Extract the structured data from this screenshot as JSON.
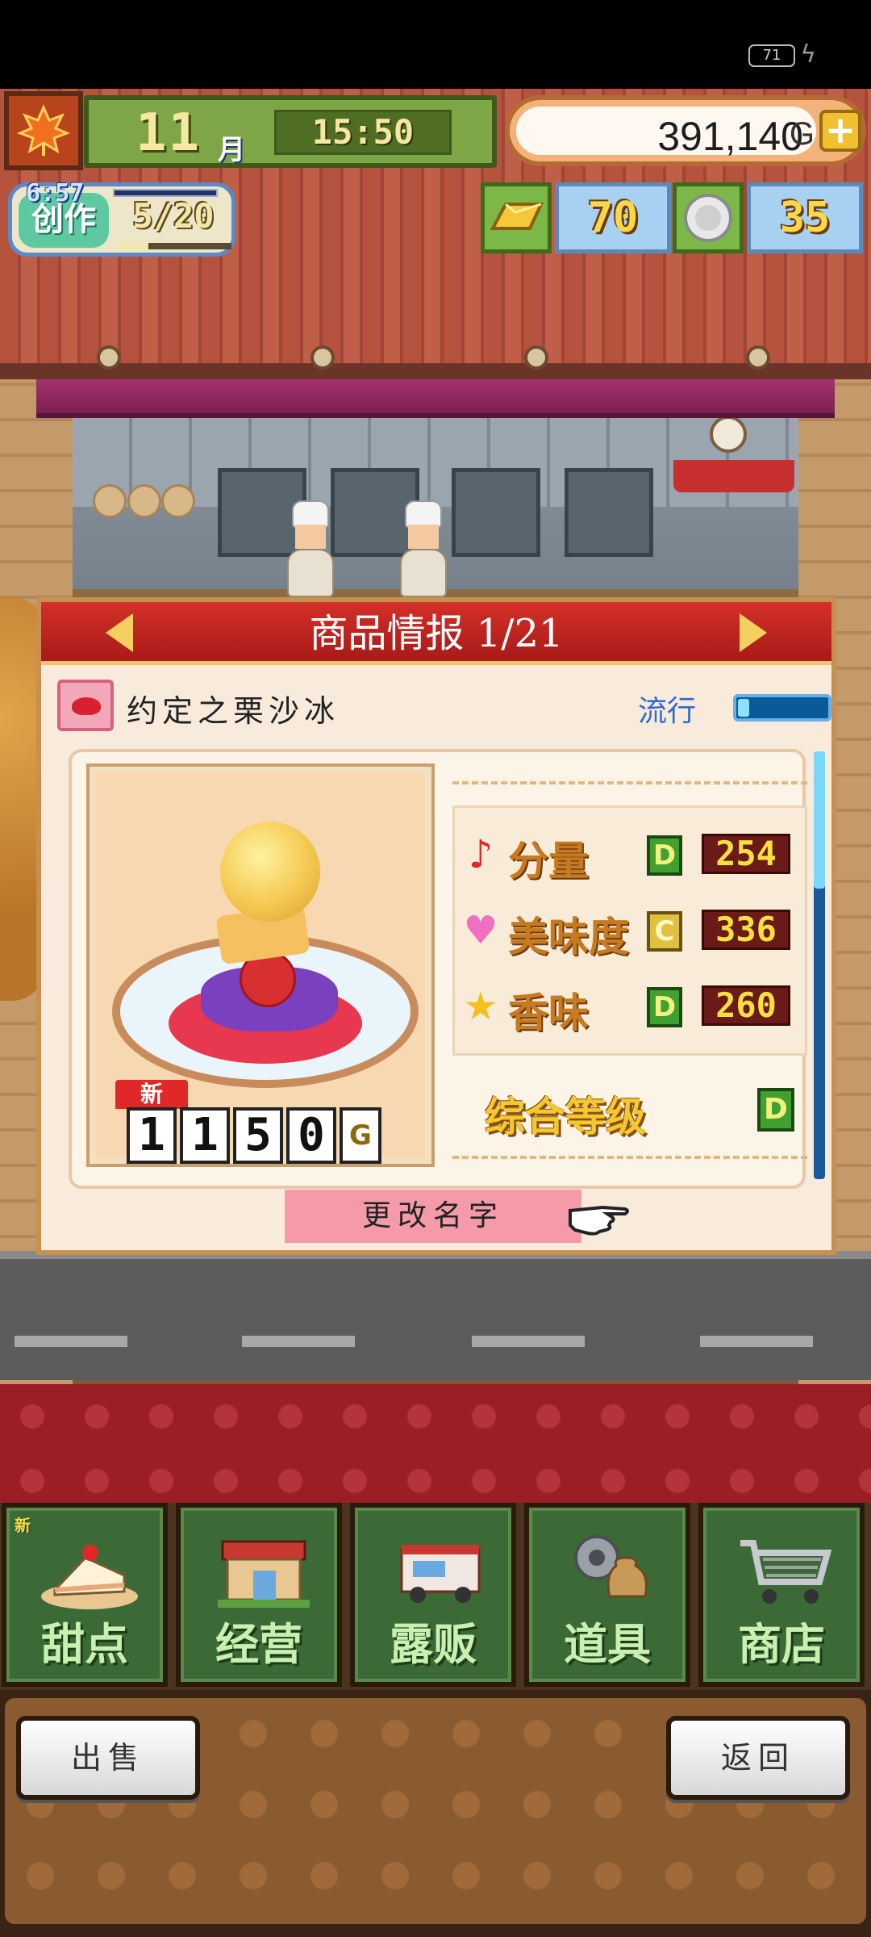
{
  "status_bar": {
    "battery": "71"
  },
  "hud": {
    "month_number": "11",
    "month_unit": "月",
    "time": "15:50",
    "money": "391,140",
    "money_unit": "G",
    "create_timer": "6:57",
    "create_label": "创作",
    "create_count": "5/20",
    "create_progress": 0.25,
    "gold_bars": "70",
    "medals": "35"
  },
  "modal": {
    "title": "商品情报 1/21",
    "item_name": "约定之栗沙冰",
    "trend_label": "流行",
    "trend_level": 0.12,
    "new_badge": "新",
    "price_digits": [
      "1",
      "1",
      "5",
      "0"
    ],
    "price_unit": "G",
    "stats": [
      {
        "label": "分量",
        "icon": "note-icon",
        "grade": "D",
        "value": "254"
      },
      {
        "label": "美味度",
        "icon": "heart-icon",
        "grade": "C",
        "value": "336"
      },
      {
        "label": "香味",
        "icon": "star-icon",
        "grade": "D",
        "value": "260"
      }
    ],
    "overall_label": "综合等级",
    "overall_grade": "D",
    "rename_button": "更改名字"
  },
  "menu": {
    "items": [
      {
        "label": "甜点",
        "icon": "cake-icon",
        "badge": "新"
      },
      {
        "label": "经营",
        "icon": "shop-building-icon"
      },
      {
        "label": "露贩",
        "icon": "food-truck-icon"
      },
      {
        "label": "道具",
        "icon": "gear-bag-icon"
      },
      {
        "label": "商店",
        "icon": "cart-icon"
      }
    ]
  },
  "footer": {
    "sell_button": "出售",
    "back_button": "返回"
  },
  "colors": {
    "header_red": "#c22420",
    "menu_green": "#3c6a36",
    "stat_value_bg": "#6a1a18",
    "grade_green": "#40a030",
    "grade_yellow": "#e0c040"
  }
}
